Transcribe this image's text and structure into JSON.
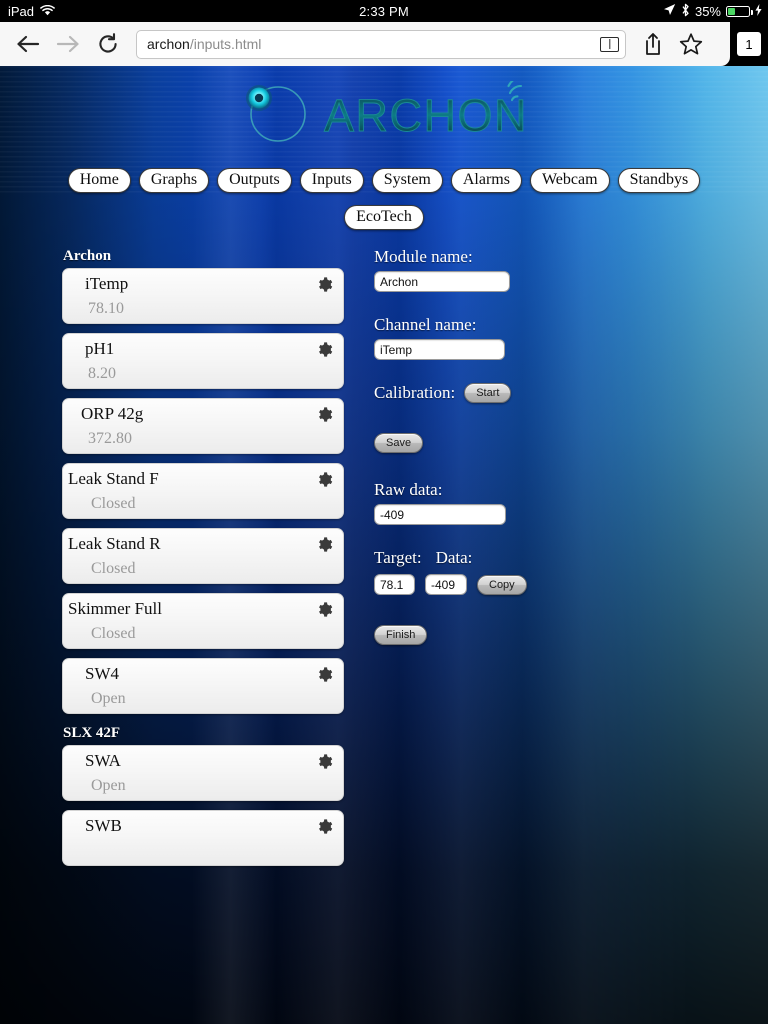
{
  "statusbar": {
    "device": "iPad",
    "wifi_icon": "wifi-icon",
    "time": "2:33 PM",
    "location_icon": "location-arrow-icon",
    "bluetooth_icon": "bluetooth-icon",
    "battery_percent": "35%",
    "battery_icon": "battery-charging-icon"
  },
  "browser": {
    "back_icon": "back-arrow-icon",
    "forward_icon": "forward-arrow-icon",
    "reload_icon": "reload-icon",
    "url_host": "archon",
    "url_path": "/inputs.html",
    "reader_icon": "reader-view-icon",
    "share_icon": "share-icon",
    "bookmark_icon": "bookmark-star-icon",
    "tab_count": "1"
  },
  "logo": {
    "wordmark": "ARCHON",
    "emblem_icon": "archon-circle-emblem-icon",
    "signal_icon": "wifi-signal-arcs-icon"
  },
  "nav": {
    "items": [
      {
        "label": "Home"
      },
      {
        "label": "Graphs"
      },
      {
        "label": "Outputs"
      },
      {
        "label": "Inputs"
      },
      {
        "label": "System"
      },
      {
        "label": "Alarms"
      },
      {
        "label": "Webcam"
      },
      {
        "label": "Standbys"
      },
      {
        "label": "EcoTech"
      }
    ]
  },
  "channel_list": {
    "groups": [
      {
        "header": "Archon",
        "items": [
          {
            "name": "iTemp",
            "value": "78.10",
            "indent": 22
          },
          {
            "name": "pH1",
            "value": "8.20",
            "indent": 22
          },
          {
            "name": "ORP 42g",
            "value": "372.80",
            "indent": 18
          },
          {
            "name": "Leak Stand F",
            "value": "Closed",
            "indent": 5
          },
          {
            "name": "Leak Stand R",
            "value": "Closed",
            "indent": 5
          },
          {
            "name": "Skimmer Full",
            "value": "Closed",
            "indent": 5
          },
          {
            "name": "SW4",
            "value": "Open",
            "indent": 22
          }
        ]
      },
      {
        "header": "SLX 42F",
        "items": [
          {
            "name": "SWA",
            "value": "Open",
            "indent": 22
          },
          {
            "name": "SWB",
            "value": "",
            "indent": 22
          }
        ]
      }
    ],
    "gear_icon": "gear-icon"
  },
  "form": {
    "module_label": "Module name:",
    "module_value": "Archon",
    "channel_label": "Channel name:",
    "channel_value": "iTemp",
    "calibration_label": "Calibration:",
    "start_button": "Start",
    "save_button": "Save",
    "raw_label": "Raw data:",
    "raw_value": "-409",
    "target_label": "Target:",
    "data_label": "Data:",
    "target_value": "78.1",
    "data_value": "-409",
    "copy_button": "Copy",
    "finish_button": "Finish"
  },
  "colors": {
    "accent_blue": "#0b44c2",
    "deep_navy": "#021a3a",
    "light_cyan": "#6fc7ef",
    "battery_green": "#4CD764",
    "logo_teal": "#0e6a72"
  }
}
